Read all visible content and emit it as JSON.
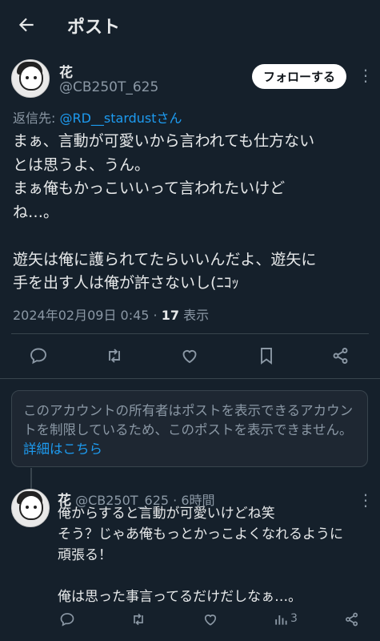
{
  "header": {
    "title": "ポスト"
  },
  "post": {
    "name": "花",
    "handle": "@CB250T_625",
    "follow_label": "フォローする",
    "reply_prefix": "返信先: ",
    "reply_target": "@RD__stardustさん",
    "text": "まぁ、言動が可愛いから言われても仕方ない\nとは思うよ、うん。\nまぁ俺もかっこいいって言われたいけど\nね…。\n\n遊矢は俺に護られてたらいいんだよ、遊矢に\n手を出す人は俺が許さないし(ﾆｺｯ",
    "timestamp": "2024年02月09日 0:45 · ",
    "views_count": "17",
    "views_label": " 表示"
  },
  "notice": {
    "text": "このアカウントの所有者はポストを表示できるアカウントを制限しているため、このポストを表示できません。",
    "link": "詳細はこちら"
  },
  "reply": {
    "name": "花",
    "handle_time": "@CB250T_625 · 6時間",
    "text": "俺からすると言動が可愛いけどね笑\nそう？じゃあ俺もっとかっこよくなれるように\n頑張る！\n\n俺は思った事言ってるだけだしなぁ…。",
    "views_count": "3"
  },
  "colors": {
    "background": "#15202b",
    "accent": "#1d9bf0",
    "muted": "#8b98a5"
  }
}
